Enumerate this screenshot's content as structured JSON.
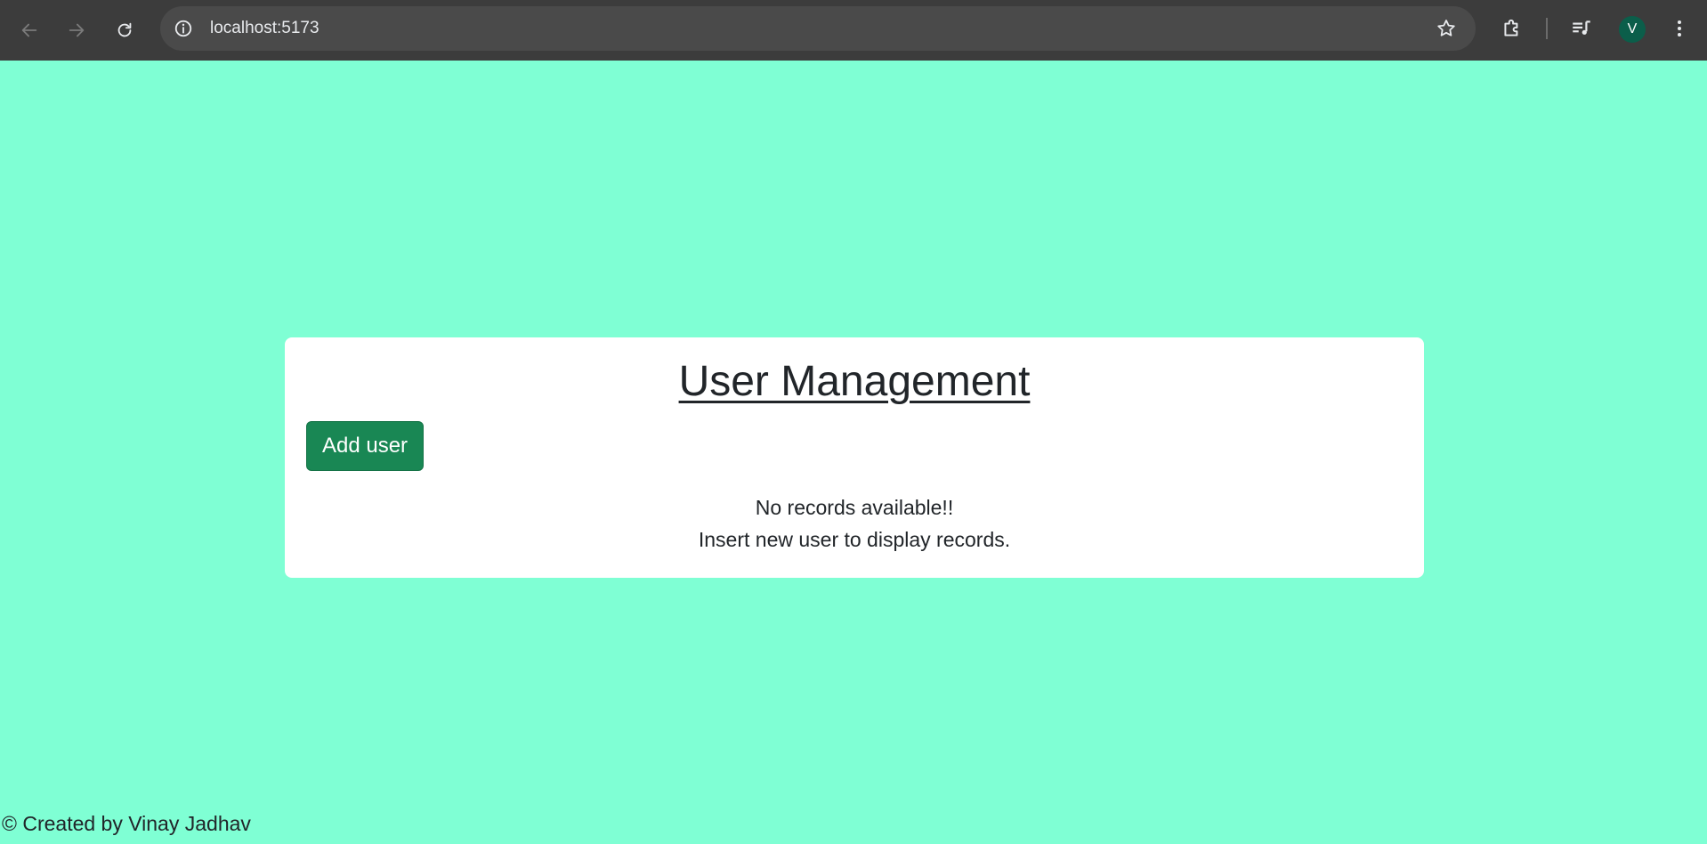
{
  "browser": {
    "url": "localhost:5173",
    "profile_initial": "V",
    "icons": {
      "back": "arrow-left-icon",
      "forward": "arrow-right-icon",
      "reload": "reload-icon",
      "site_info": "info-icon",
      "bookmark": "star-icon",
      "extensions": "puzzle-icon",
      "media": "media-queue-icon",
      "menu": "kebab-menu-icon"
    }
  },
  "page": {
    "background_color": "#7fffd4",
    "card": {
      "title": "User Management",
      "add_button_label": "Add user",
      "empty_message_line1": "No records available!!",
      "empty_message_line2": "Insert new user to display records."
    },
    "footer_text": "© Created by Vinay Jadhav"
  }
}
